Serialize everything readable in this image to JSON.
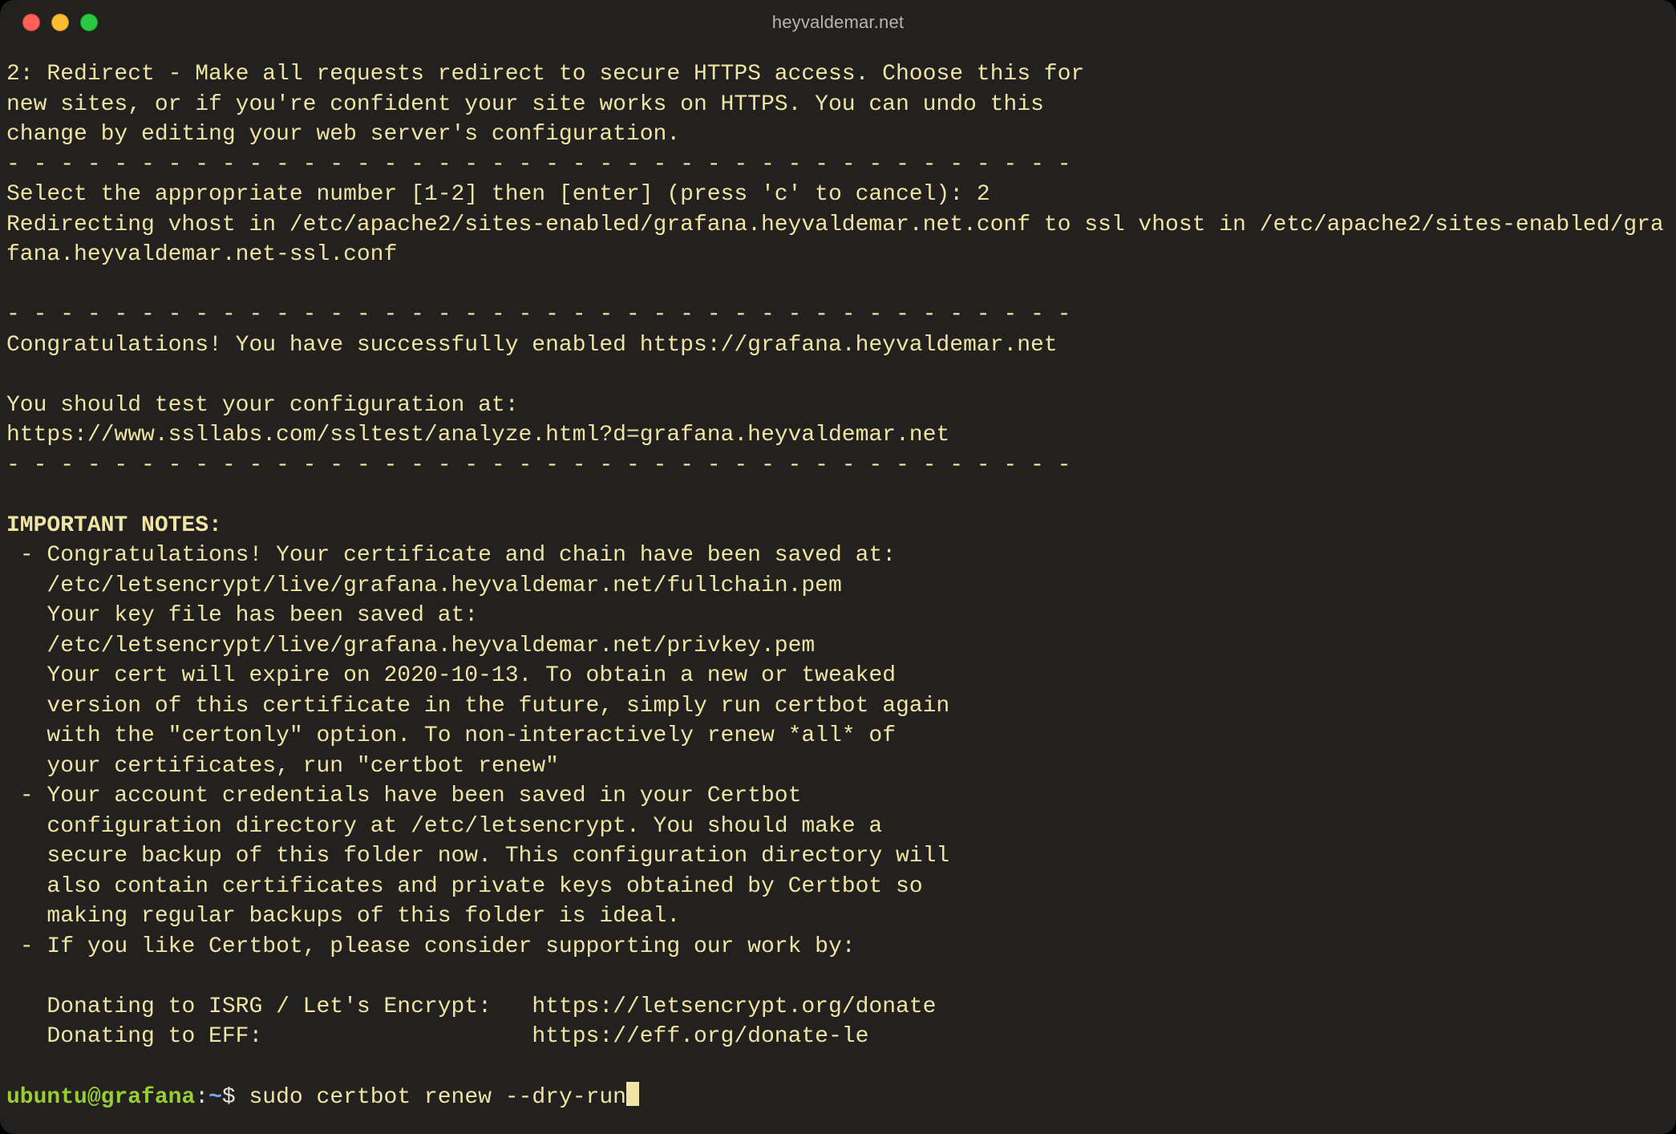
{
  "window": {
    "title": "heyvaldemar.net"
  },
  "terminal": {
    "lines": [
      "2: Redirect - Make all requests redirect to secure HTTPS access. Choose this for",
      "new sites, or if you're confident your site works on HTTPS. You can undo this",
      "change by editing your web server's configuration.",
      "- - - - - - - - - - - - - - - - - - - - - - - - - - - - - - - - - - - - - - - -",
      "Select the appropriate number [1-2] then [enter] (press 'c' to cancel): 2",
      "Redirecting vhost in /etc/apache2/sites-enabled/grafana.heyvaldemar.net.conf to ssl vhost in /etc/apache2/sites-enabled/grafana.heyvaldemar.net-ssl.conf",
      "",
      "- - - - - - - - - - - - - - - - - - - - - - - - - - - - - - - - - - - - - - - -",
      "Congratulations! You have successfully enabled https://grafana.heyvaldemar.net",
      "",
      "You should test your configuration at:",
      "https://www.ssllabs.com/ssltest/analyze.html?d=grafana.heyvaldemar.net",
      "- - - - - - - - - - - - - - - - - - - - - - - - - - - - - - - - - - - - - - - -",
      ""
    ],
    "important_heading": "IMPORTANT NOTES:",
    "notes": [
      " - Congratulations! Your certificate and chain have been saved at:",
      "   /etc/letsencrypt/live/grafana.heyvaldemar.net/fullchain.pem",
      "   Your key file has been saved at:",
      "   /etc/letsencrypt/live/grafana.heyvaldemar.net/privkey.pem",
      "   Your cert will expire on 2020-10-13. To obtain a new or tweaked",
      "   version of this certificate in the future, simply run certbot again",
      "   with the \"certonly\" option. To non-interactively renew *all* of",
      "   your certificates, run \"certbot renew\"",
      " - Your account credentials have been saved in your Certbot",
      "   configuration directory at /etc/letsencrypt. You should make a",
      "   secure backup of this folder now. This configuration directory will",
      "   also contain certificates and private keys obtained by Certbot so",
      "   making regular backups of this folder is ideal.",
      " - If you like Certbot, please consider supporting our work by:",
      "",
      "   Donating to ISRG / Let's Encrypt:   https://letsencrypt.org/donate",
      "   Donating to EFF:                    https://eff.org/donate-le",
      ""
    ],
    "prompt": {
      "user": "ubuntu",
      "at": "@",
      "host": "grafana",
      "colon": ":",
      "path": "~",
      "dollar": "$ ",
      "command": "sudo certbot renew --dry-run"
    }
  }
}
